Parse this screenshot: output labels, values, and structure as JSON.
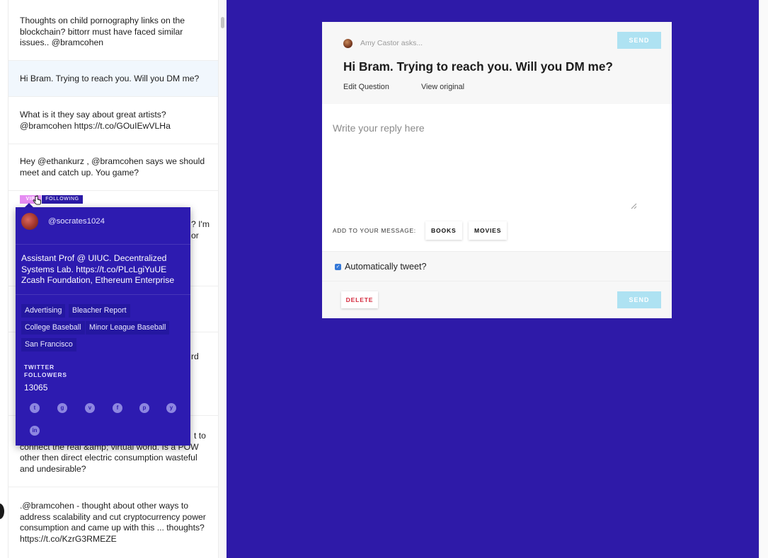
{
  "questions": [
    {
      "text": "Thoughts on child pornography links on the blockchain? bittorr must have faced similar issues.. @bramcohen"
    },
    {
      "text": "Hi Bram. Trying to reach you. Will you DM me?"
    },
    {
      "text": "What is it they say about great artists? @bramcohen https://t.co/GOuIEwVLHa"
    },
    {
      "text": "Hey @ethankurz , @bramcohen says we should meet and catch up. You game?"
    },
    {
      "tail_1": "? I'm",
      "tail_2": "or"
    },
    {
      "tail": "rd"
    },
    {
      "tail": "t to"
    },
    {
      "text": "connect the real &amp; virtual world. Is a POW other then direct electric consumption wasteful and undesirable?"
    },
    {
      "text": ".@bramcohen - thought about other ways to address scalability and cut cryptocurrency power consumption and came up with this ... thoughts? https://t.co/KzrG3RMEZE"
    }
  ],
  "badges": {
    "vip": "VIP",
    "following": "FOLLOWING"
  },
  "popup": {
    "handle": "@socrates1024",
    "bio": "Assistant Prof @ UIUC. Decentralized Systems Lab. https://t.co/PLcLgiYuUE Zcash Foundation, Ethereum Enterprise",
    "tags": [
      "Advertising",
      "Bleacher Report",
      "College Baseball",
      "Minor League Baseball",
      "San Francisco"
    ],
    "followers_label": "TWITTER FOLLOWERS",
    "followers_count": "13065",
    "social_icons": [
      "twitter-icon",
      "github-icon",
      "vimeo-icon",
      "foursquare-icon",
      "pinterest-icon",
      "yelp-icon",
      "linkedin-icon"
    ]
  },
  "card": {
    "asker": "Amy Castor asks...",
    "send_label": "SEND",
    "question": "Hi Bram. Trying to reach you. Will you DM me?",
    "edit_label": "Edit Question",
    "view_label": "View original",
    "reply_placeholder": "Write your reply here",
    "add_label": "ADD TO YOUR MESSAGE:",
    "chips": [
      "BOOKS",
      "MOVIES"
    ],
    "auto_tweet_label": "Automatically tweet?",
    "delete_label": "DELETE"
  },
  "colors": {
    "panel_bg": "#2e1aa8",
    "popup_bg": "#2d1bb0",
    "send_button": "#aee2f2",
    "delete_text": "#d42a3d",
    "vip_badge": "#e58cf2"
  }
}
